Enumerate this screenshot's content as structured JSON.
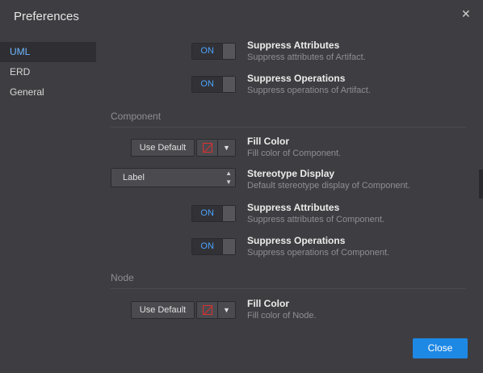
{
  "dialog": {
    "title": "Preferences",
    "close_icon": "close-icon"
  },
  "sidebar": {
    "items": [
      {
        "label": "UML",
        "active": true
      },
      {
        "label": "ERD",
        "active": false
      },
      {
        "label": "General",
        "active": false
      }
    ]
  },
  "artifact": {
    "suppress_attributes": {
      "state": "ON",
      "name": "Suppress Attributes",
      "desc": "Suppress attributes of Artifact."
    },
    "suppress_operations": {
      "state": "ON",
      "name": "Suppress Operations",
      "desc": "Suppress operations of Artifact."
    }
  },
  "component": {
    "header": "Component",
    "fill_color": {
      "use_default": "Use Default",
      "caret": "▼",
      "name": "Fill Color",
      "desc": "Fill color of Component."
    },
    "stereotype_display": {
      "value": "Label",
      "arrows": "▲▼",
      "name": "Stereotype Display",
      "desc": "Default stereotype display of Component."
    },
    "suppress_attributes": {
      "state": "ON",
      "name": "Suppress Attributes",
      "desc": "Suppress attributes of Component."
    },
    "suppress_operations": {
      "state": "ON",
      "name": "Suppress Operations",
      "desc": "Suppress operations of Component."
    }
  },
  "node": {
    "header": "Node",
    "fill_color": {
      "use_default": "Use Default",
      "caret": "▼",
      "name": "Fill Color",
      "desc": "Fill color of Node."
    }
  },
  "footer": {
    "close_label": "Close"
  },
  "colors": {
    "accent": "#1e88e5",
    "toggle_on": "#4aa3ff",
    "active_sidebar": "#6fb6ff",
    "swatch": "#e03030"
  }
}
